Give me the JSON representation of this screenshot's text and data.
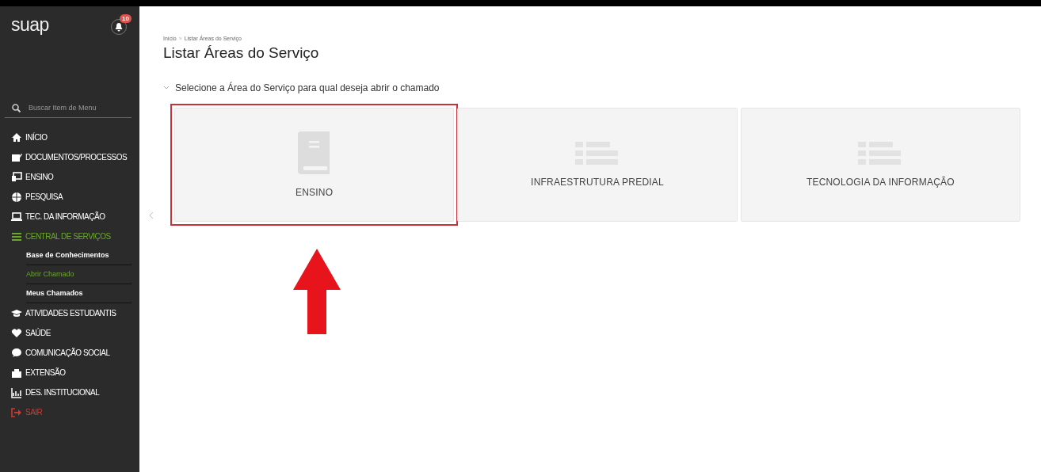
{
  "sidebar": {
    "logo": "suap",
    "notifications": "10",
    "search": {
      "placeholder": "Buscar Item de Menu"
    },
    "items": [
      {
        "label": "INÍCIO",
        "selected": false
      },
      {
        "label": "DOCUMENTOS/PROCESSOS",
        "selected": false
      },
      {
        "label": "ENSINO",
        "selected": false
      },
      {
        "label": "PESQUISA",
        "selected": false
      },
      {
        "label": "TEC. DA INFORMAÇÃO",
        "selected": false
      },
      {
        "label": "CENTRAL DE SERVIÇOS",
        "selected": true,
        "children": [
          {
            "label": "Base de Conhecimentos",
            "selected": false
          },
          {
            "label": "Abrir Chamado",
            "selected": true
          },
          {
            "label": "Meus Chamados",
            "selected": false
          }
        ]
      },
      {
        "label": "ATIVIDADES ESTUDANTIS",
        "selected": false
      },
      {
        "label": "SAÚDE",
        "selected": false
      },
      {
        "label": "COMUNICAÇÃO SOCIAL",
        "selected": false
      },
      {
        "label": "EXTENSÃO",
        "selected": false
      },
      {
        "label": "DES. INSTITUCIONAL",
        "selected": false
      },
      {
        "label": "SAIR",
        "selected": false
      }
    ]
  },
  "breadcrumb": [
    "Início",
    "Listar Áreas do Serviço"
  ],
  "breadcrumb_separator": "»",
  "title": "Listar Áreas do Serviço",
  "section": {
    "label": "Selecione a Área do Serviço para qual deseja abrir o chamado",
    "expanded": true
  },
  "cards": [
    {
      "label": "ENSINO",
      "highlighted": true
    },
    {
      "label": "INFRAESTRUTURA PREDIAL",
      "highlighted": false
    },
    {
      "label": "TECNOLOGIA DA INFORMAÇÃO",
      "highlighted": false
    }
  ]
}
